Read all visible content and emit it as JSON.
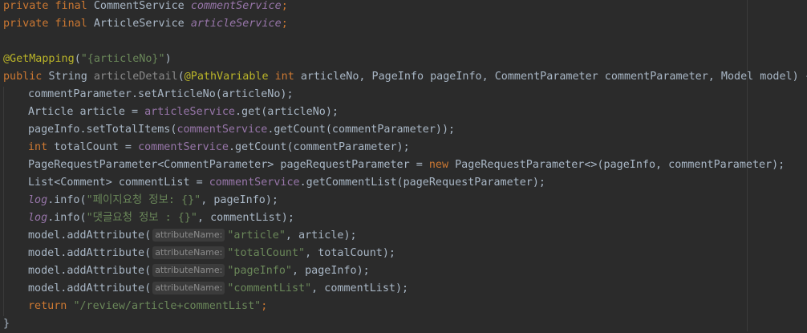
{
  "code": {
    "l1": {
      "kw": "private final ",
      "type": "CommentService ",
      "field": "commentService",
      "end": ";"
    },
    "l2": {
      "kw": "private final ",
      "type": "ArticleService ",
      "field": "articleService",
      "end": ";"
    },
    "l4": {
      "ann": "@GetMapping",
      "open": "(",
      "str": "\"{articleNo}\"",
      "close": ")"
    },
    "l5": {
      "kw1": "public ",
      "type": "String ",
      "method": "articleDetail",
      "open": "(",
      "ann": "@PathVariable ",
      "kw2": "int ",
      "rest": "articleNo, PageInfo pageInfo, CommentParameter commentParameter, Model model) {"
    },
    "l6": {
      "text": "commentParameter.setArticleNo(articleNo);"
    },
    "l7": {
      "pre": "Article article = ",
      "field": "articleService",
      "post": ".get(articleNo);"
    },
    "l8": {
      "pre": "pageInfo.setTotalItems(",
      "field": "commentService",
      "post": ".getCount(commentParameter));"
    },
    "l9": {
      "kw": "int ",
      "pre": "totalCount = ",
      "field": "commentService",
      "post": ".getCount(commentParameter);"
    },
    "l10": {
      "pre": "PageRequestParameter<CommentParameter> pageRequestParameter = ",
      "kw": "new ",
      "post": "PageRequestParameter<>(pageInfo, commentParameter);"
    },
    "l11": {
      "pre": "List<Comment> commentList = ",
      "field": "commentService",
      "post": ".getCommentList(pageRequestParameter);"
    },
    "l12": {
      "log": "log",
      "pre": ".info(",
      "str": "\"페이지요청 정보: {}\"",
      "post": ", pageInfo);"
    },
    "l13": {
      "log": "log",
      "pre": ".info(",
      "str": "\"댓글요청 정보 : {}\"",
      "post": ", commentList);"
    },
    "l14": {
      "pre": "model.addAttribute(",
      "hint": "attributeName:",
      "str": "\"article\"",
      "post": ", article);"
    },
    "l15": {
      "pre": "model.addAttribute(",
      "hint": "attributeName:",
      "str": "\"totalCount\"",
      "post": ", totalCount);"
    },
    "l16": {
      "pre": "model.addAttribute(",
      "hint": "attributeName:",
      "str": "\"pageInfo\"",
      "post": ", pageInfo);"
    },
    "l17": {
      "pre": "model.addAttribute(",
      "hint": "attributeName:",
      "str": "\"commentList\"",
      "post": ", commentList);"
    },
    "l18": {
      "kw": "return ",
      "str": "\"/review/article+commentList\"",
      "end": ";"
    },
    "l19": {
      "text": "}"
    }
  },
  "colors": {
    "background": "#2b2b2b",
    "default_text": "#a9b7c6",
    "keyword": "#cc7832",
    "field": "#9876aa",
    "string": "#6a8759",
    "annotation": "#bbb529"
  }
}
